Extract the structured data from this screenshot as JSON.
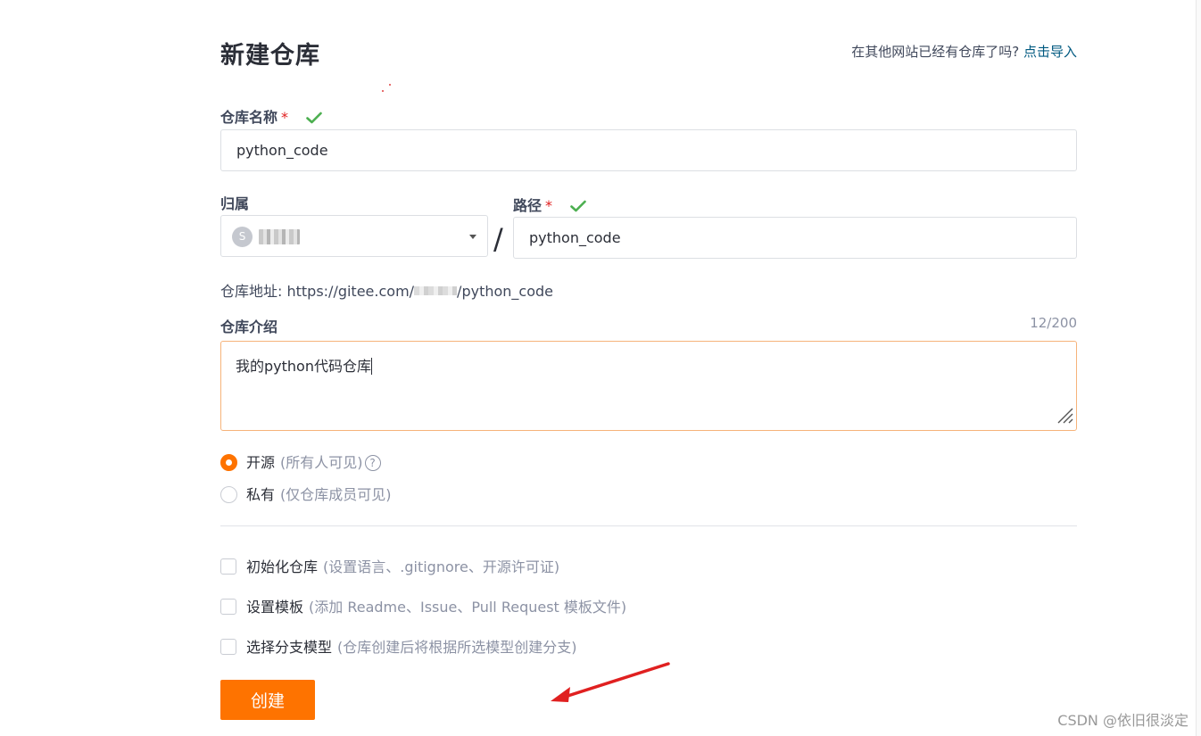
{
  "header": {
    "title": "新建仓库",
    "import_prompt": "在其他网站已经有仓库了吗?",
    "import_link": "点击导入"
  },
  "repo_name": {
    "label": "仓库名称",
    "required_mark": "*",
    "value": "python_code"
  },
  "owner": {
    "label": "归属",
    "avatar_letter": "S"
  },
  "path_separator": "/",
  "path": {
    "label": "路径",
    "required_mark": "*",
    "value": "python_code"
  },
  "repo_url": {
    "prefix": "仓库地址: https://gitee.com/",
    "suffix": "/python_code"
  },
  "description": {
    "label": "仓库介绍",
    "counter": "12/200",
    "value": "我的python代码仓库"
  },
  "visibility": {
    "options": [
      {
        "label": "开源",
        "hint": "(所有人可见)",
        "selected": true
      },
      {
        "label": "私有",
        "hint": "(仅仓库成员可见)",
        "selected": false
      }
    ],
    "help_glyph": "?"
  },
  "init_options": [
    {
      "label": "初始化仓库",
      "hint": "(设置语言、.gitignore、开源许可证)",
      "checked": false
    },
    {
      "label": "设置模板",
      "hint": "(添加 Readme、Issue、Pull Request 模板文件)",
      "checked": false
    },
    {
      "label": "选择分支模型",
      "hint": "(仓库创建后将根据所选模型创建分支)",
      "checked": false
    }
  ],
  "create_button": "创建",
  "watermark": "CSDN @依旧很淡定",
  "colors": {
    "accent": "#fe7300",
    "link": "#005980",
    "success": "#4caf50",
    "required": "#e02020",
    "annotation_arrow": "#e02020"
  },
  "icons": {
    "valid": "check-icon",
    "dropdown": "chevron-down-icon",
    "help": "question-circle-icon",
    "resize": "resize-grip-icon",
    "annotation": "arrow-icon"
  }
}
